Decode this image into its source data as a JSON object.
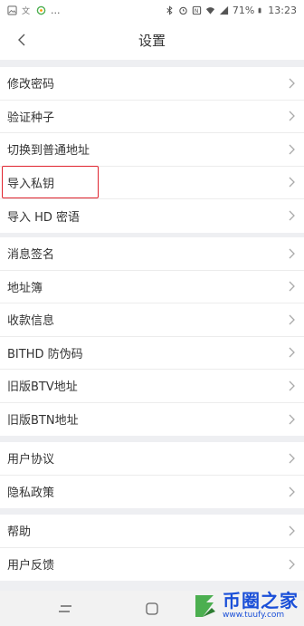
{
  "status_bar": {
    "left_dots": "...",
    "battery": "71%",
    "time": "13:23"
  },
  "header": {
    "title": "设置"
  },
  "groups": [
    {
      "items": [
        {
          "label": "修改密码"
        },
        {
          "label": "验证种子"
        },
        {
          "label": "切换到普通地址"
        },
        {
          "label": "导入私钥"
        },
        {
          "label": "导入 HD 密语"
        }
      ]
    },
    {
      "items": [
        {
          "label": "消息签名"
        },
        {
          "label": "地址簿"
        },
        {
          "label": "收款信息"
        },
        {
          "label": "BITHD 防伪码"
        },
        {
          "label": "旧版BTV地址"
        },
        {
          "label": "旧版BTN地址"
        }
      ]
    },
    {
      "items": [
        {
          "label": "用户协议"
        },
        {
          "label": "隐私政策"
        }
      ]
    },
    {
      "items": [
        {
          "label": "帮助"
        },
        {
          "label": "用户反馈"
        }
      ]
    }
  ],
  "highlighted_item": "导入私钥",
  "watermark": {
    "title": "币圈之家",
    "url": "www.tuufy.com"
  },
  "colors": {
    "highlight_border": "#e0242f",
    "watermark_blue": "#1a4fd8",
    "background": "#eeeff2"
  }
}
